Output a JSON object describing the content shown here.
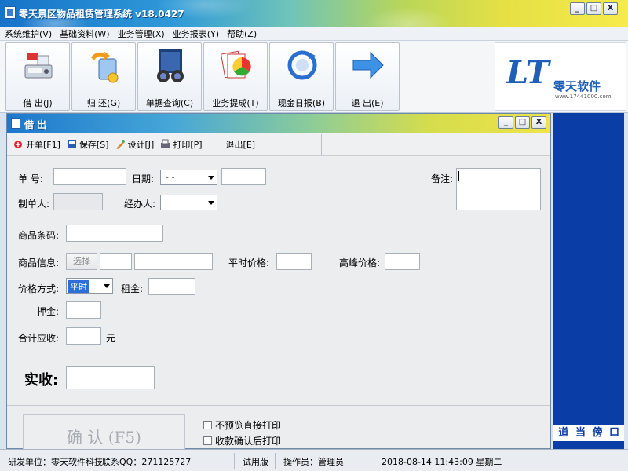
{
  "window": {
    "title": "零天景区物品租赁管理系统  v18.0427",
    "controls": [
      "_",
      "□",
      "X"
    ]
  },
  "menu": [
    "系统维护(V)",
    "基础资料(W)",
    "业务管理(X)",
    "业务报表(Y)",
    "帮助(Z)"
  ],
  "toolbar": [
    {
      "label": "借 出(J)",
      "icon": "register-icon"
    },
    {
      "label": "归 还(G)",
      "icon": "return-icon"
    },
    {
      "label": "单据查询(C)",
      "icon": "binoculars-icon"
    },
    {
      "label": "业务提成(T)",
      "icon": "pie-chart-icon"
    },
    {
      "label": "现金日报(B)",
      "icon": "refresh-report-icon"
    },
    {
      "label": "退 出(E)",
      "icon": "arrow-right-icon"
    }
  ],
  "logo": {
    "text": "零天软件",
    "url": "www.17441000.com",
    "letters": "LT"
  },
  "inner": {
    "title": "借 出",
    "controls": [
      "_",
      "□",
      "X"
    ],
    "toolbar": [
      {
        "label": "开单[F1]",
        "icon": "new-icon"
      },
      {
        "label": "保存[S]",
        "icon": "save-icon"
      },
      {
        "label": "设计[J]",
        "icon": "design-icon"
      },
      {
        "label": "打印[P]",
        "icon": "print-icon"
      },
      {
        "label": "退出[E]",
        "icon": ""
      }
    ],
    "form": {
      "order_no_label": "单  号:",
      "date_label": "日期:",
      "date_value": " - -",
      "remark_label": "备注:",
      "creator_label": "制单人:",
      "handler_label": "经办人:",
      "barcode_label": "商品条码:",
      "info_label": "商品信息:",
      "select_button": "选择",
      "normal_price_label": "平时价格:",
      "peak_price_label": "高峰价格:",
      "price_mode_label": "价格方式:",
      "price_mode_value": "平时",
      "rent_label": "租金:",
      "deposit_label": "押金:",
      "total_label": "合计应收:",
      "unit": "元",
      "received_label": "实收:",
      "confirm_button": "确 认 (F5)",
      "cb1": "不预览直接打印",
      "cb2": "收款确认后打印"
    }
  },
  "rightpanel": {
    "scroll_text": "道 当 傍 口"
  },
  "status": {
    "company": "研发单位：零天软件科技",
    "qq": "联系QQ：271125727",
    "edition": "试用版",
    "operator": "操作员：管理员",
    "datetime": "2018-08-14 11:43:09 星期二"
  },
  "colors": {
    "title_blue": "#1673c9",
    "panel_blue": "#0a3da6",
    "select_highlight": "#2c6fd6"
  }
}
